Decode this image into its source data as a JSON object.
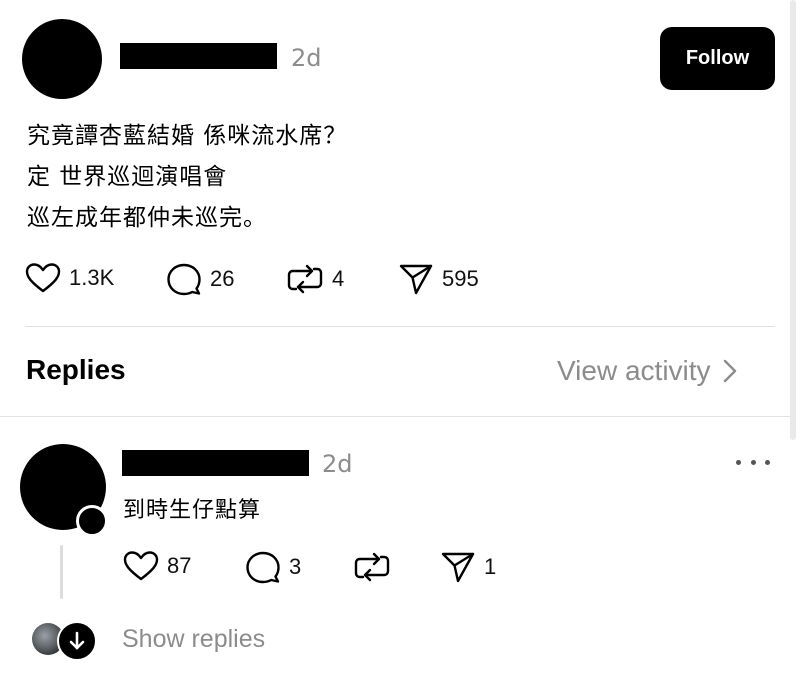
{
  "post": {
    "time": "2d",
    "follow_label": "Follow",
    "text_lines": [
      "究竟譚杏藍結婚 係咪流水席？",
      "定 世界巡迴演唱會",
      "巡左成年都仲未巡完。"
    ],
    "likes": "1.3K",
    "comments": "26",
    "reposts": "4",
    "shares": "595"
  },
  "replies_section": {
    "title": "Replies",
    "view_activity": "View activity"
  },
  "reply": {
    "time": "2d",
    "text": "到時生仔點算",
    "likes": "87",
    "comments": "3",
    "reposts": "",
    "shares": "1",
    "show_replies": "Show replies"
  },
  "icons": {
    "like": "heart-icon",
    "comment": "speech-bubble-icon",
    "repost": "repost-icon",
    "share": "paper-plane-icon",
    "more": "more-dots-icon",
    "chevron": "chevron-right-icon",
    "down": "arrow-down-icon"
  }
}
